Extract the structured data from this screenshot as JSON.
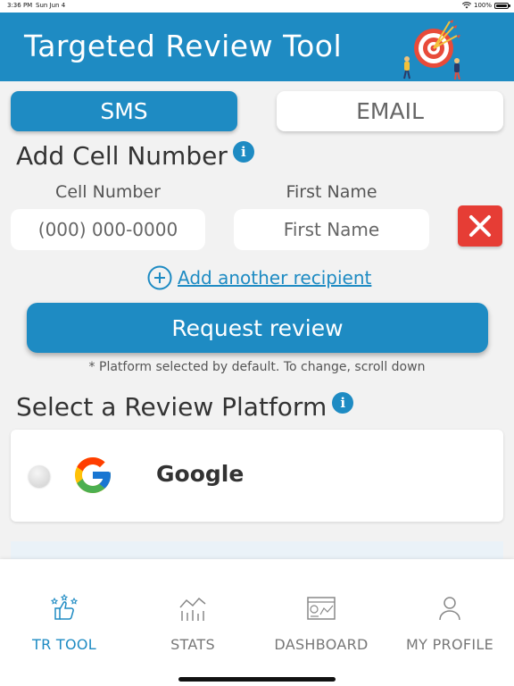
{
  "status_bar": {
    "time": "3:36 PM",
    "date": "Sun Jun 4",
    "battery": "100%"
  },
  "header": {
    "title": "Targeted Review Tool",
    "logo_icon": "target-arrows-icon"
  },
  "tabs": {
    "sms": "SMS",
    "email": "EMAIL"
  },
  "add_cell": {
    "title": "Add Cell Number",
    "cell_label": "Cell Number",
    "name_label": "First Name",
    "cell_placeholder": "(000) 000-0000",
    "name_placeholder": "First Name",
    "cell_value": "",
    "name_value": ""
  },
  "add_recipient": {
    "label": "Add another recipient"
  },
  "request_button": {
    "label": "Request review"
  },
  "note": "* Platform selected by default. To change, scroll down",
  "platform_section": {
    "title": "Select a Review Platform",
    "items": [
      {
        "name": "Google",
        "selected": false,
        "icon": "google-logo"
      }
    ]
  },
  "tabbar": {
    "items": [
      {
        "label": "TR TOOL",
        "icon": "thumbs-up-stars-icon",
        "active": true
      },
      {
        "label": "STATS",
        "icon": "stats-chart-icon",
        "active": false
      },
      {
        "label": "DASHBOARD",
        "icon": "dashboard-icon",
        "active": false
      },
      {
        "label": "MY PROFILE",
        "icon": "user-icon",
        "active": false
      }
    ]
  },
  "colors": {
    "primary": "#1e8bc3",
    "delete": "#e63d35",
    "background": "#f2f2f2"
  }
}
